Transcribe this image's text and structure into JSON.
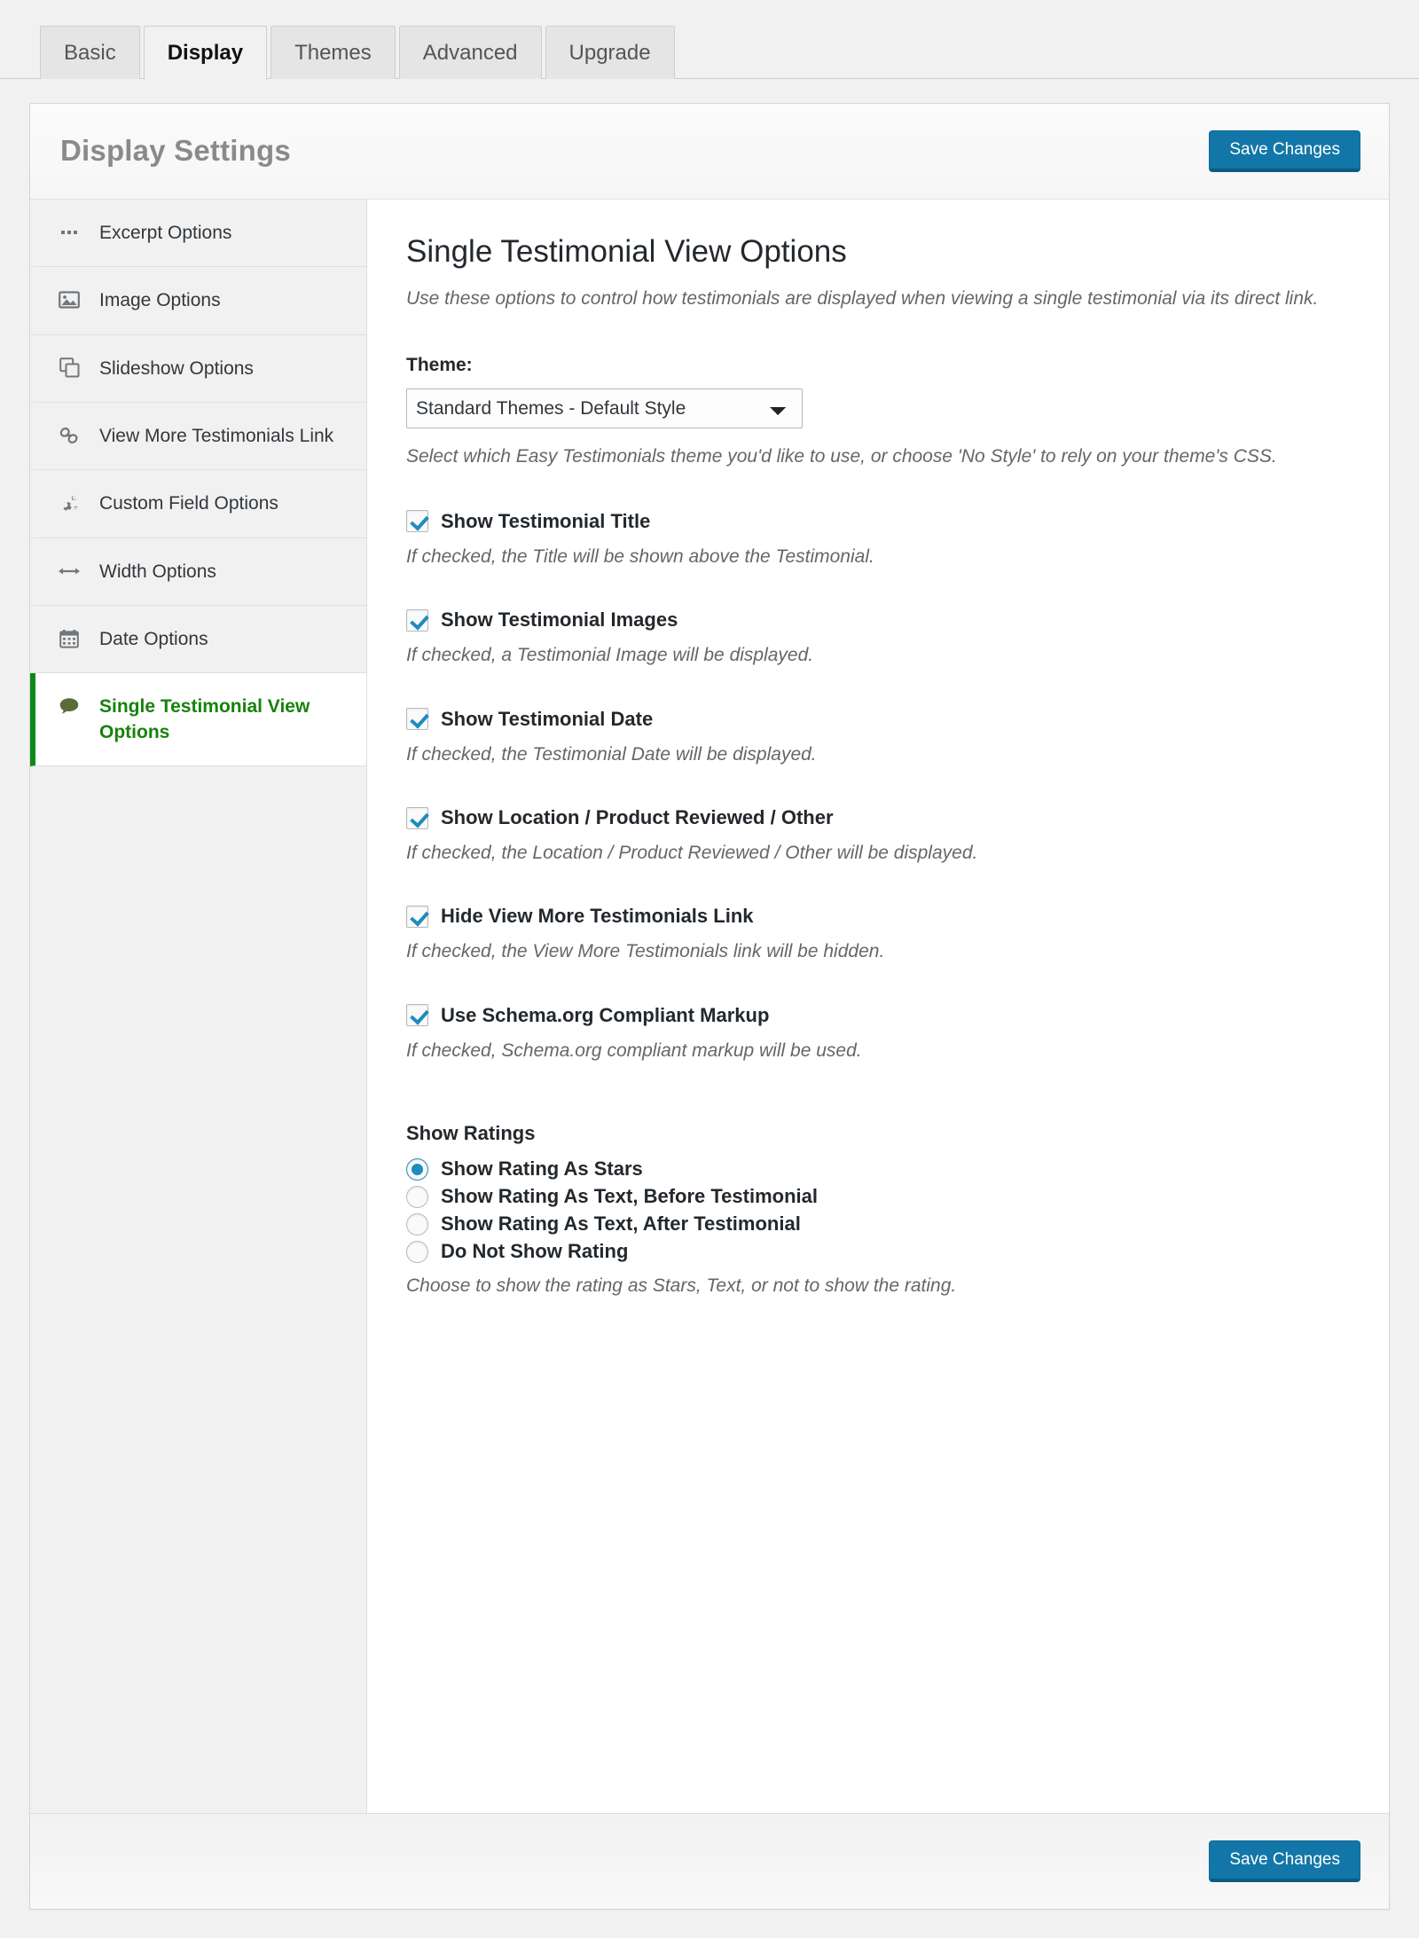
{
  "tabs": [
    {
      "label": "Basic",
      "active": false
    },
    {
      "label": "Display",
      "active": true
    },
    {
      "label": "Themes",
      "active": false
    },
    {
      "label": "Advanced",
      "active": false
    },
    {
      "label": "Upgrade",
      "active": false
    }
  ],
  "header": {
    "title": "Display Settings",
    "save_label": "Save Changes"
  },
  "footer": {
    "save_label": "Save Changes"
  },
  "sidebar": {
    "items": [
      {
        "label": "Excerpt Options",
        "icon": "ellipsis-icon"
      },
      {
        "label": "Image Options",
        "icon": "image-icon"
      },
      {
        "label": "Slideshow Options",
        "icon": "copy-icon"
      },
      {
        "label": "View More Testimonials Link",
        "icon": "link-icon"
      },
      {
        "label": "Custom Field Options",
        "icon": "gears-icon"
      },
      {
        "label": "Width Options",
        "icon": "arrows-horizontal-icon"
      },
      {
        "label": "Date Options",
        "icon": "calendar-icon"
      },
      {
        "label": "Single Testimonial View Options",
        "icon": "comment-icon"
      }
    ]
  },
  "main": {
    "title": "Single Testimonial View Options",
    "description": "Use these options to control how testimonials are displayed when viewing a single testimonial via its direct link.",
    "theme": {
      "label": "Theme:",
      "selected": "Standard Themes - Default Style",
      "help": "Select which Easy Testimonials theme you'd like to use, or choose 'No Style' to rely on your theme's CSS."
    },
    "checkboxes": [
      {
        "label": "Show Testimonial Title",
        "help": "If checked, the Title will be shown above the Testimonial.",
        "checked": true
      },
      {
        "label": "Show Testimonial Images",
        "help": "If checked, a Testimonial Image will be displayed.",
        "checked": true
      },
      {
        "label": "Show Testimonial Date",
        "help": "If checked, the Testimonial Date will be displayed.",
        "checked": true
      },
      {
        "label": "Show Location / Product Reviewed / Other",
        "help": "If checked, the Location / Product Reviewed / Other will be displayed.",
        "checked": true
      },
      {
        "label": "Hide View More Testimonials Link",
        "help": "If checked, the View More Testimonials link will be hidden.",
        "checked": true
      },
      {
        "label": "Use Schema.org Compliant Markup",
        "help": "If checked, Schema.org compliant markup will be used.",
        "checked": true
      }
    ],
    "ratings": {
      "title": "Show Ratings",
      "options": [
        {
          "label": "Show Rating As Stars",
          "selected": true
        },
        {
          "label": "Show Rating As Text, Before Testimonial",
          "selected": false
        },
        {
          "label": "Show Rating As Text, After Testimonial",
          "selected": false
        },
        {
          "label": "Do Not Show Rating",
          "selected": false
        }
      ],
      "help": "Choose to show the rating as Stars, Text, or not to show the rating."
    }
  },
  "colors": {
    "accent_blue": "#1277a8",
    "active_green": "#17820a",
    "checkbox_blue": "#1e8cbe"
  }
}
